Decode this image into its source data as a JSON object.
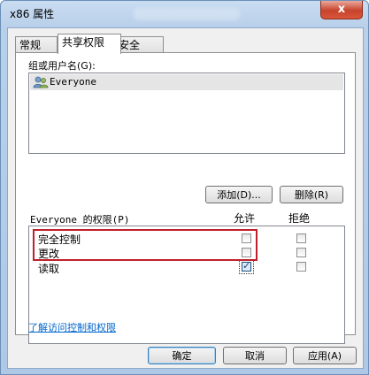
{
  "window": {
    "title": "x86 属性",
    "blurred_title": "Windows",
    "close_glyph": "x"
  },
  "tabs": [
    {
      "label": "常规",
      "active": false
    },
    {
      "label": "共享权限",
      "active": true
    },
    {
      "label": "安全",
      "active": false
    }
  ],
  "groups": {
    "label": "组或用户名(G):",
    "items": [
      {
        "name": "Everyone",
        "icon": "users-icon",
        "selected": true
      }
    ]
  },
  "buttons": {
    "add": "添加(D)...",
    "remove": "删除(R)",
    "ok": "确定",
    "cancel": "取消",
    "apply": "应用(A)"
  },
  "permissions": {
    "label": "Everyone 的权限(P)",
    "allow_header": "允许",
    "deny_header": "拒绝",
    "rows": [
      {
        "name": "完全控制",
        "allow": false,
        "deny": false
      },
      {
        "name": "更改",
        "allow": false,
        "deny": false
      },
      {
        "name": "读取",
        "allow": true,
        "deny": false
      }
    ]
  },
  "link": "了解访问控制和权限",
  "colors": {
    "highlight": "#c0202a",
    "link": "#0066cc"
  }
}
